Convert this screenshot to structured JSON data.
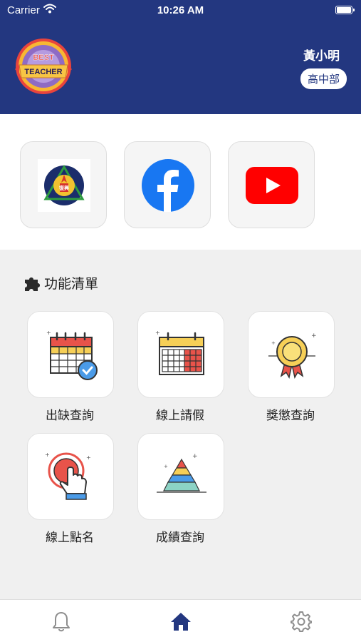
{
  "status_bar": {
    "carrier": "Carrier",
    "time": "10:26 AM"
  },
  "header": {
    "logo_line1": "BEST",
    "logo_line2": "TEACHER",
    "user_name": "黃小明",
    "department": "高中部"
  },
  "links": [
    {
      "name": "school-emblem",
      "icon": "school-emblem-icon",
      "emblem_text": "復興"
    },
    {
      "name": "facebook",
      "icon": "facebook-icon",
      "color": "#1877F2"
    },
    {
      "name": "youtube",
      "icon": "youtube-icon",
      "color": "#FF0000"
    }
  ],
  "features": {
    "title": "功能清單",
    "items": [
      {
        "label": "出缺查詢",
        "icon": "calendar-check-icon"
      },
      {
        "label": "線上請假",
        "icon": "calendar-grid-icon"
      },
      {
        "label": "獎懲查詢",
        "icon": "award-badge-icon"
      },
      {
        "label": "線上點名",
        "icon": "tap-button-icon"
      },
      {
        "label": "成績查詢",
        "icon": "pyramid-chart-icon"
      }
    ]
  },
  "tabbar": {
    "tabs": [
      {
        "icon": "bell-icon",
        "active": false
      },
      {
        "icon": "home-icon",
        "active": true
      },
      {
        "icon": "gear-icon",
        "active": false
      }
    ],
    "active_color": "#233780",
    "inactive_color": "#8e8e8e"
  },
  "colors": {
    "header_bg": "#233780",
    "page_bg": "#f0f0f0"
  }
}
